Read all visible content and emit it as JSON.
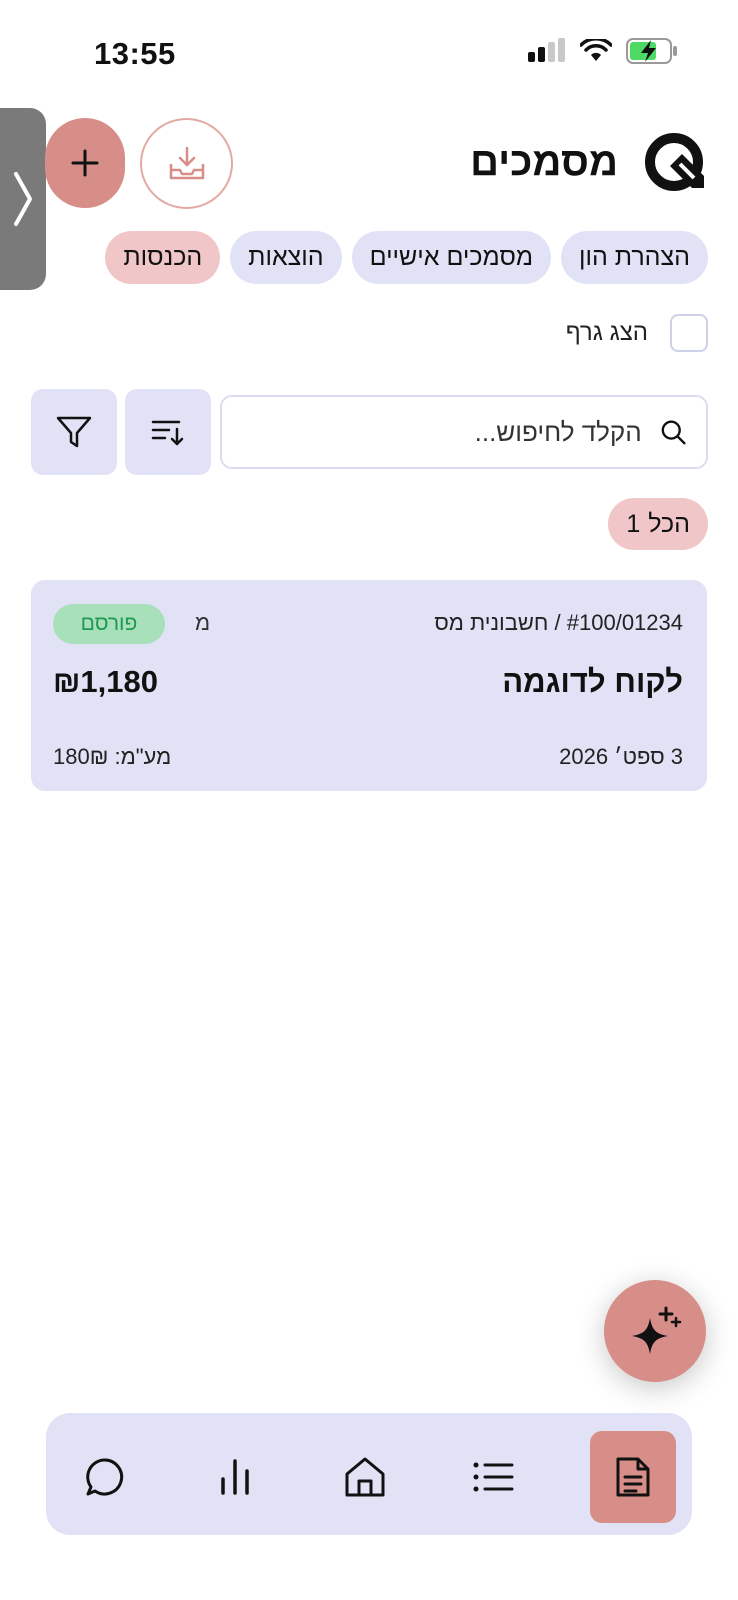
{
  "status_bar": {
    "time": "13:55",
    "icons": [
      "signal-icon",
      "wifi-icon",
      "battery-charging-icon"
    ]
  },
  "header": {
    "title": "מסמכים",
    "add_button_icon": "plus-icon",
    "download_button_icon": "download-tray-icon",
    "side_tab_icon": "chevron-right-icon"
  },
  "tabs": [
    {
      "label": "הכנסות",
      "active": true
    },
    {
      "label": "הוצאות",
      "active": false
    },
    {
      "label": "מסמכים אישיים",
      "active": false
    },
    {
      "label": "הצהרת הון",
      "active": false
    }
  ],
  "graph_toggle": {
    "label": "הצג גרף",
    "checked": false
  },
  "search": {
    "placeholder": "הקלד לחיפוש...",
    "value": ""
  },
  "filter_chip": {
    "label": "הכל",
    "count": "1"
  },
  "documents": [
    {
      "number": "#100/01234 / חשבונית מס",
      "type_letter": "מ",
      "status": "פורסם",
      "customer": "לקוח לדוגמה",
      "amount": "₪1,180",
      "date": "3 ספט׳ 2026",
      "vat": "מע\"מ: 180₪"
    }
  ],
  "colors": {
    "accent": "#d78e88",
    "chip_active": "#f0c6c8",
    "surface": "#e1e2f6",
    "badge_bg": "#a8e0bc",
    "badge_text": "#1f9a50"
  },
  "bottom_nav": [
    {
      "icon": "document-icon",
      "active": true
    },
    {
      "icon": "list-icon",
      "active": false
    },
    {
      "icon": "home-icon",
      "active": false
    },
    {
      "icon": "bar-chart-icon",
      "active": false
    },
    {
      "icon": "chat-bubble-icon",
      "active": false
    }
  ],
  "ai_button_icon": "sparkles-icon"
}
